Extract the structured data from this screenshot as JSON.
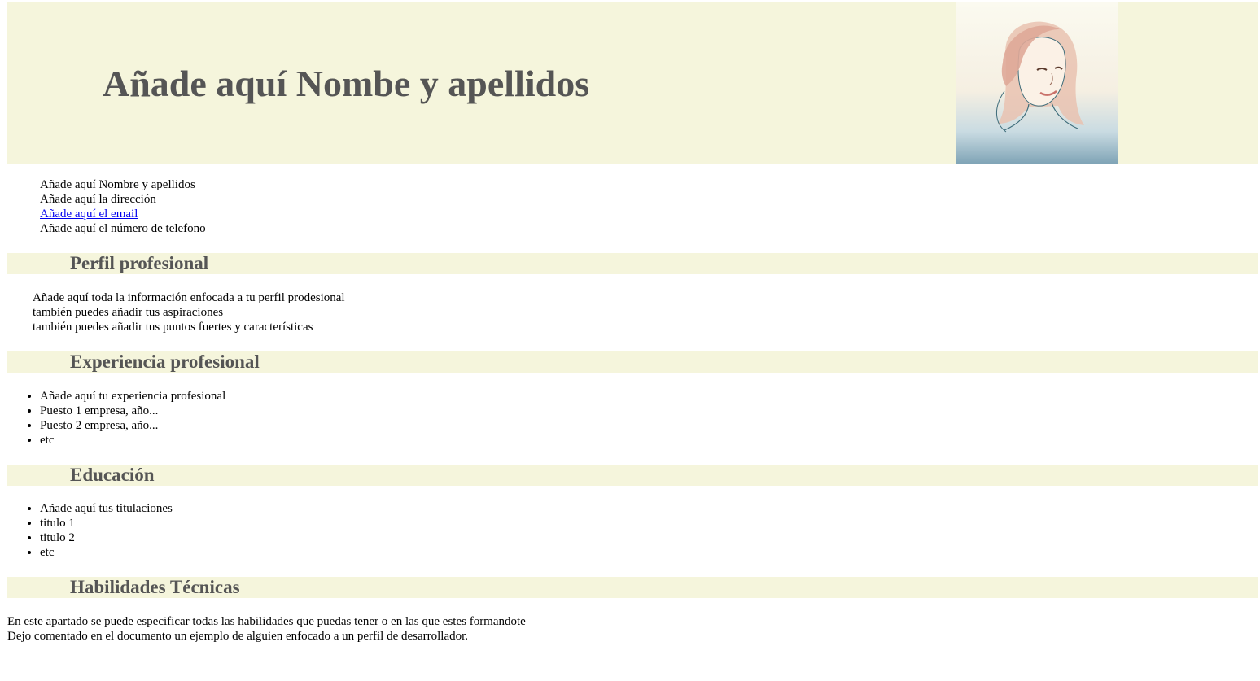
{
  "header": {
    "name_title": "Añade aquí Nombe y apellidos"
  },
  "contact": {
    "name": "Añade aquí Nombre y apellidos",
    "address": "Añade aquí la dirección",
    "email": "Añade aquí el email",
    "phone": "Añade aquí el número de telefono"
  },
  "perfil": {
    "title": "Perfil profesional",
    "lines": [
      "Añade aquí toda la información enfocada a tu perfil prodesional",
      "también puedes añadir tus aspiraciones",
      "también puedes añadir tus puntos fuertes y características"
    ]
  },
  "experiencia": {
    "title": "Experiencia profesional",
    "items": [
      "Añade aquí tu experiencia profesional",
      "Puesto 1 empresa, año...",
      "Puesto 2 empresa, año...",
      "etc"
    ]
  },
  "educacion": {
    "title": "Educación",
    "items": [
      "Añade aquí tus titulaciones",
      "titulo 1",
      "titulo 2",
      "etc"
    ]
  },
  "habilidades": {
    "title": "Habilidades Técnicas",
    "lines": [
      "En este apartado se puede especificar todas las habilidades que puedas tener o en las que estes formandote",
      "Dejo comentado en el documento un ejemplo de alguien enfocado a un perfil de desarrollador."
    ]
  },
  "colors": {
    "section_background": "#f5f5dc",
    "heading_text": "#555555",
    "link": "#0000ee"
  }
}
